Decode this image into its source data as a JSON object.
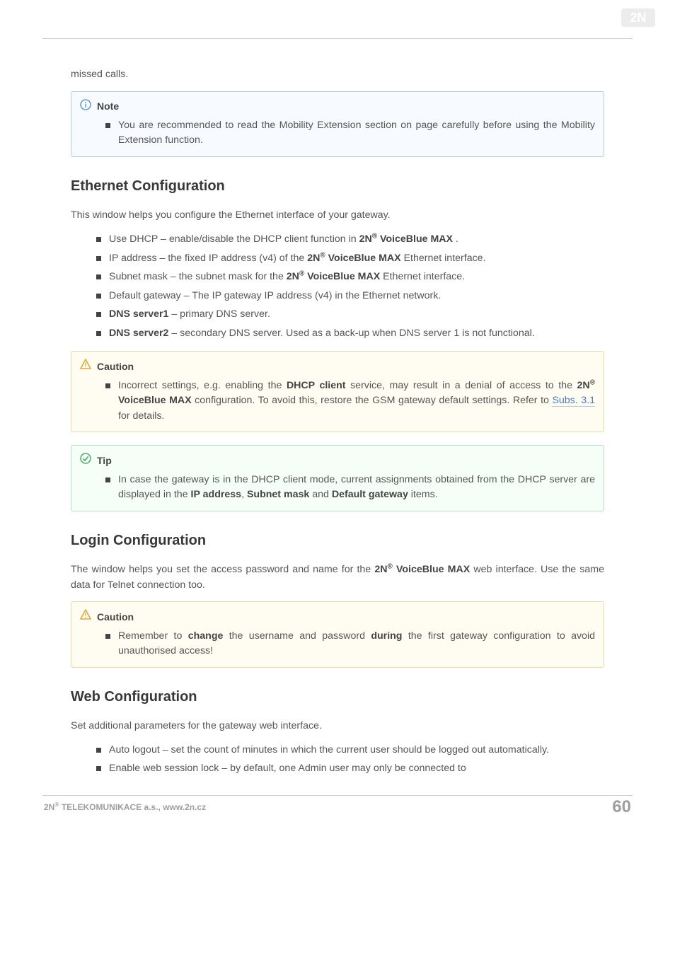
{
  "intro_text": "missed calls.",
  "note_head": "Note",
  "note_b1a": "You are recommended to read the Mobility Extension section on page carefully before using the Mobility Extension function.",
  "sec_eth_title": "Ethernet Configuration",
  "sec_eth_intro": "This window helps you configure the Ethernet interface of your gateway.",
  "eth_b1_pre": "Use DHCP – enable/disable the DHCP client function in ",
  "eth_b1_prod_pre": "2N",
  "eth_b1_prod_post": " VoiceBlue MAX",
  "eth_b1_post": " .",
  "eth_b2_pre": "IP address – the fixed IP address (v4) of the ",
  "eth_b2_prod_pre": "2N",
  "eth_b2_prod_post": " VoiceBlue MAX",
  "eth_b2_post": "  Ethernet interface.",
  "eth_b3_pre": "Subnet mask – the subnet mask for the ",
  "eth_b3_prod_pre": "2N",
  "eth_b3_prod_post": " VoiceBlue MAX",
  "eth_b3_post": "  Ethernet interface.",
  "eth_b4": "Default gateway – The IP gateway IP address (v4) in the Ethernet network.",
  "eth_b5_lbl": "DNS server1",
  "eth_b5_post": " – primary DNS server.",
  "eth_b6_lbl": "DNS server2",
  "eth_b6_post": " – secondary DNS server. Used as a back-up when DNS server 1 is not functional.",
  "caution1_head": "Caution",
  "caution1_b1_pre": "Incorrect settings, e.g. enabling the ",
  "caution1_b1_dhcp": "DHCP client",
  "caution1_b1_mid1": " service, may result in a denial of access to the ",
  "caution1_b1_prod_pre": "2N",
  "caution1_b1_prod_post": " VoiceBlue MAX",
  "caution1_b1_mid2": " configuration. To avoid this, restore the GSM gateway default settings. Refer to ",
  "caution1_b1_link": "Subs. 3.1",
  "caution1_b1_post": " for details.",
  "tip_head": "Tip",
  "tip_b1_pre": "In case the gateway is in the DHCP client mode, current assignments obtained from the DHCP server are displayed in the ",
  "tip_ip": "IP address",
  "tip_comma": ", ",
  "tip_subnet": "Subnet mask",
  "tip_and": " and ",
  "tip_gw": "Default gateway",
  "tip_post": " items.",
  "sec_login_title": "Login Configuration",
  "login_p_pre": "The window helps you set the access password and name for the ",
  "login_prod_pre": "2N",
  "login_prod_post": " VoiceBlue MAX",
  "login_p_post": " web interface. Use the same data for Telnet connection too.",
  "caution2_head": "Caution",
  "caution2_b1_pre": "Remember to ",
  "caution2_b1_change": "change",
  "caution2_b1_mid": " the username and password ",
  "caution2_b1_during": "during",
  "caution2_b1_post": " the first gateway configuration to avoid unauthorised access!",
  "sec_web_title": "Web Configuration",
  "web_intro": "Set additional parameters for the gateway web interface.",
  "web_b1": "Auto logout – set the count of minutes in which the current user should be logged out automatically.",
  "web_b2": "Enable web session lock – by default, one Admin user may only be connected to",
  "footer_left_pre": "2N",
  "footer_left_post": " TELEKOMUNIKACE a.s., www.2n.cz",
  "footer_page": "60"
}
